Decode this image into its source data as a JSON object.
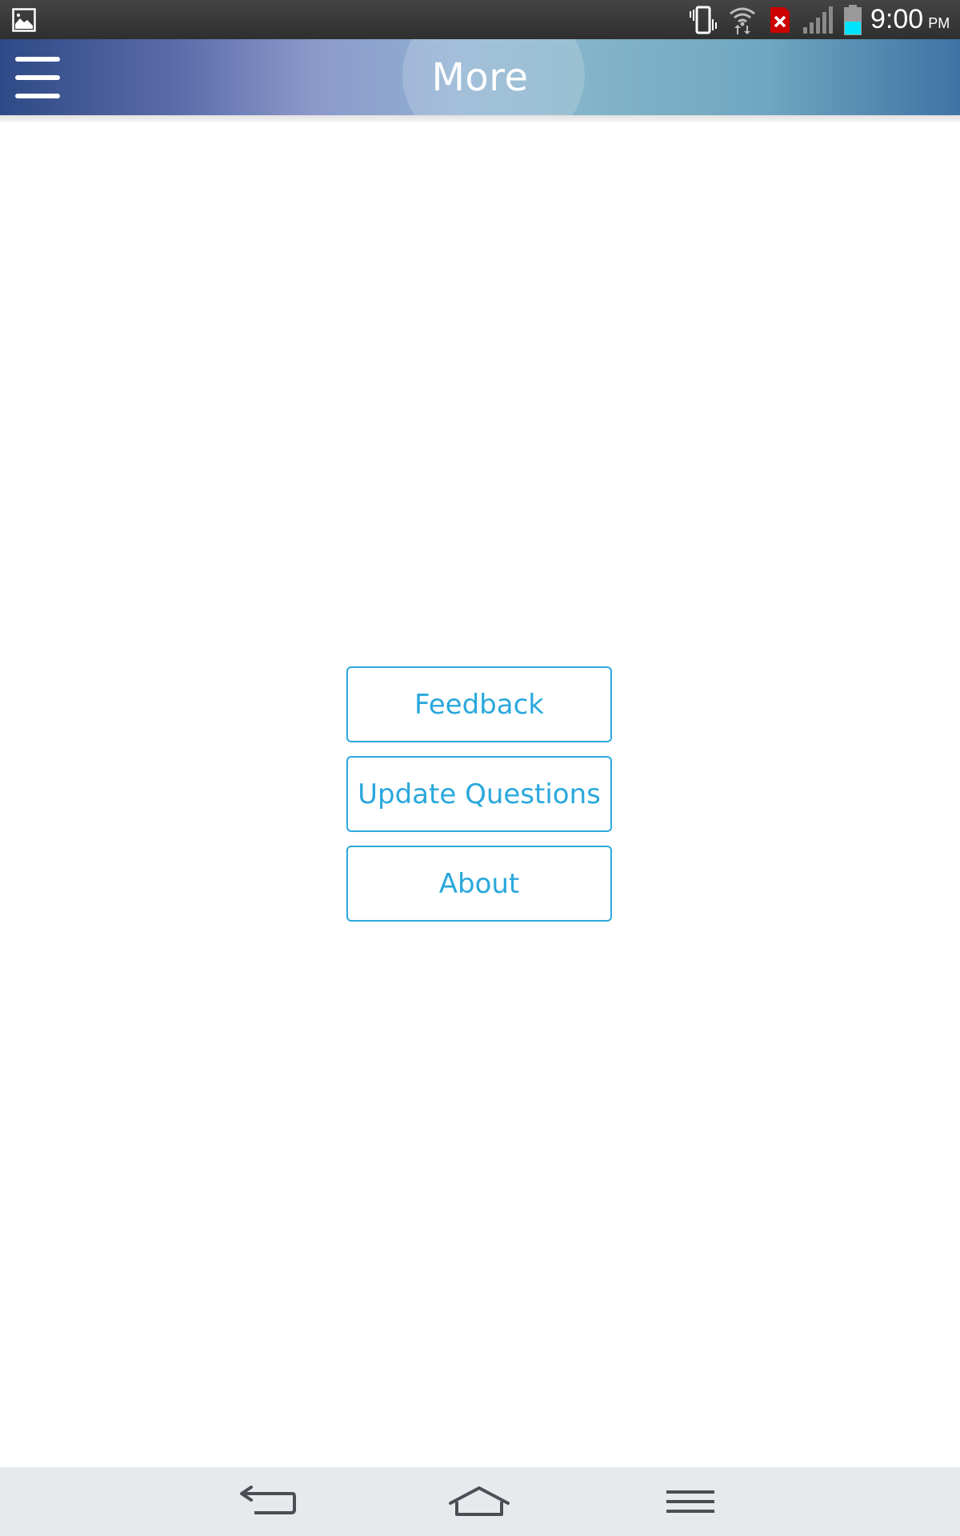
{
  "status_bar": {
    "time": "9:00",
    "ampm": "PM",
    "icons": {
      "left": "image-notification-icon",
      "vibrate": "vibrate-icon",
      "wifi": "wifi-icon",
      "sim": "no-sim-icon",
      "signal": "signal-icon",
      "battery": "battery-icon"
    },
    "colors": {
      "sim_alert": "#cc0000",
      "battery_level": "#00e5ff"
    }
  },
  "app_bar": {
    "title": "More",
    "menu_icon": "hamburger-menu-icon"
  },
  "options": {
    "feedback_label": "Feedback",
    "update_questions_label": "Update Questions",
    "about_label": "About"
  },
  "nav_bar": {
    "back_icon": "back-icon",
    "home_icon": "home-icon",
    "menu_icon": "menu-icon"
  },
  "colors": {
    "accent": "#2aa8dc",
    "header_start": "#2e4a86",
    "header_end": "#3e73a4",
    "nav_bar_bg": "#e6eaed"
  }
}
